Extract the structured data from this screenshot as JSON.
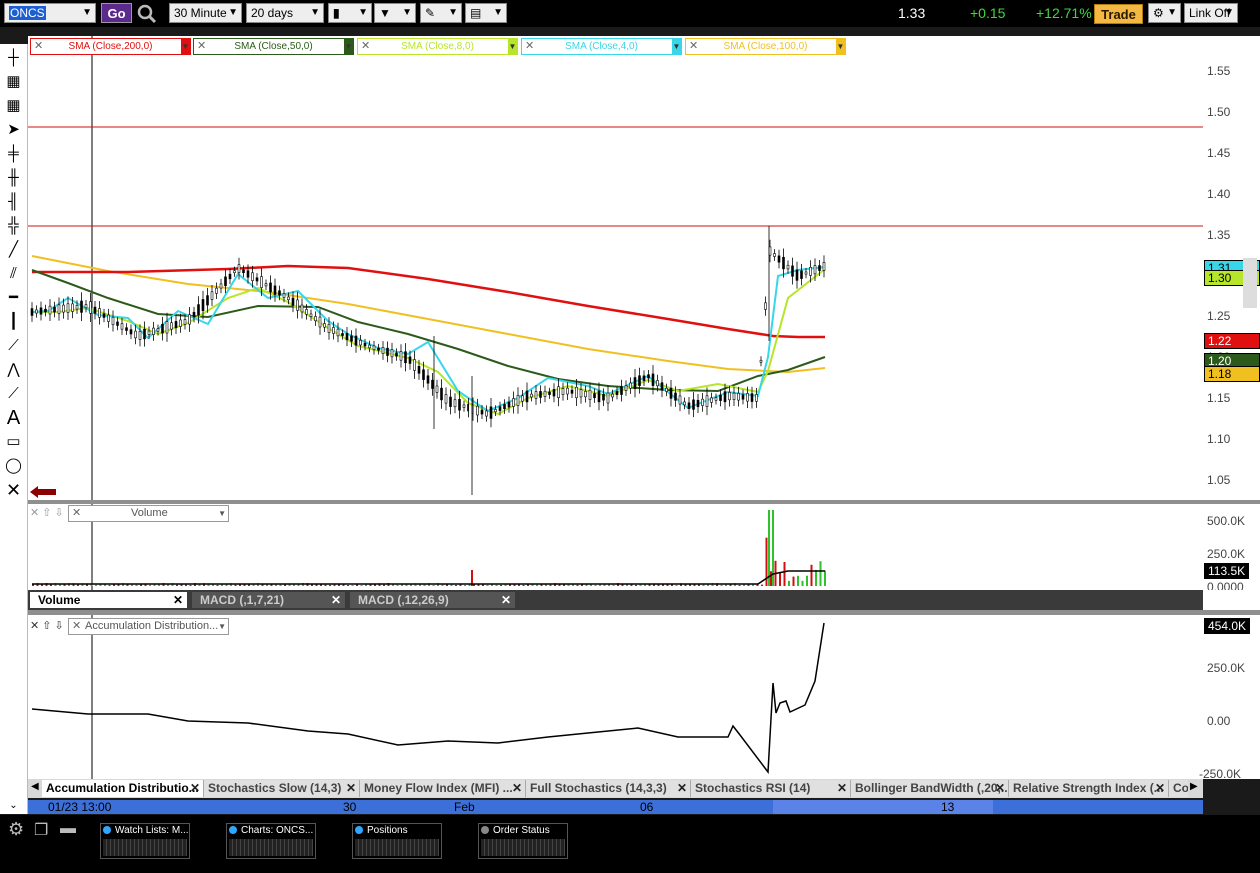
{
  "toolbar": {
    "symbol": "ONCS",
    "go_label": "Go",
    "interval": "30 Minute",
    "range": "20 days",
    "last_price": "1.33",
    "change": "+0.15",
    "change_pct": "+12.71%",
    "trade_label": "Trade",
    "link_label": "Link Off",
    "colors": {
      "up": "#3ed93e",
      "trade_bg": "#f4b942"
    }
  },
  "indicators": [
    {
      "label": "SMA (Close,200,0)",
      "color": "#e01010"
    },
    {
      "label": "SMA (Close,50,0)",
      "color": "#2c5a1a"
    },
    {
      "label": "SMA (Close,8,0)",
      "color": "#b7e52a"
    },
    {
      "label": "SMA (Close,4,0)",
      "color": "#37d6e8"
    },
    {
      "label": "SMA (Close,100,0)",
      "color": "#f0c020"
    }
  ],
  "price_axis": [
    "1.55",
    "1.50",
    "1.45",
    "1.40",
    "1.35",
    "1.30",
    "1.25",
    "1.20",
    "1.15",
    "1.10",
    "1.05"
  ],
  "price_tags": [
    {
      "text": "1.31",
      "bg": "#37d6e8",
      "fg": "#000"
    },
    {
      "text": "1.30",
      "bg": "#b7e52a",
      "fg": "#000"
    },
    {
      "text": "1.22",
      "bg": "#e01010",
      "fg": "#fff"
    },
    {
      "text": "1.20",
      "bg": "#2c5a1a",
      "fg": "#fff"
    },
    {
      "text": "1.18",
      "bg": "#f0c020",
      "fg": "#000"
    }
  ],
  "volume_panel": {
    "dropdown": "Volume",
    "axis": [
      "500.0K",
      "250.0K",
      "0.0000"
    ],
    "tag": "113.5K"
  },
  "mid_tabs": [
    {
      "label": "Volume",
      "active": true
    },
    {
      "label": "MACD (,1,7,21)",
      "active": false
    },
    {
      "label": "MACD (,12,26,9)",
      "active": false
    }
  ],
  "ad_panel": {
    "dropdown": "Accumulation Distribution...",
    "axis": [
      "250.0K",
      "0.00",
      "-250.0K"
    ],
    "tag": "454.0K"
  },
  "bottom_tabs": [
    {
      "label": "Accumulation Distributio...",
      "active": true
    },
    {
      "label": "Stochastics Slow (14,3)",
      "active": false
    },
    {
      "label": "Money Flow Index (MFI) ...",
      "active": false
    },
    {
      "label": "Full Stochastics (14,3,3)",
      "active": false
    },
    {
      "label": "Stochastics RSI (14)",
      "active": false
    },
    {
      "label": "Bollinger BandWidth (,20,...",
      "active": false
    },
    {
      "label": "Relative Strength Index (...",
      "active": false
    },
    {
      "label": "Comm",
      "active": false
    }
  ],
  "time_axis": {
    "cursor": "01/23 13:00",
    "labels": [
      "30",
      "Feb",
      "06",
      "13"
    ]
  },
  "dock": [
    {
      "label": "Watch Lists: M...",
      "dot": "#2fa7ff"
    },
    {
      "label": "Charts: ONCS...",
      "dot": "#2fa7ff"
    },
    {
      "label": "Positions",
      "dot": "#2fa7ff"
    },
    {
      "label": "Order Status",
      "dot": "#888888"
    }
  ]
}
